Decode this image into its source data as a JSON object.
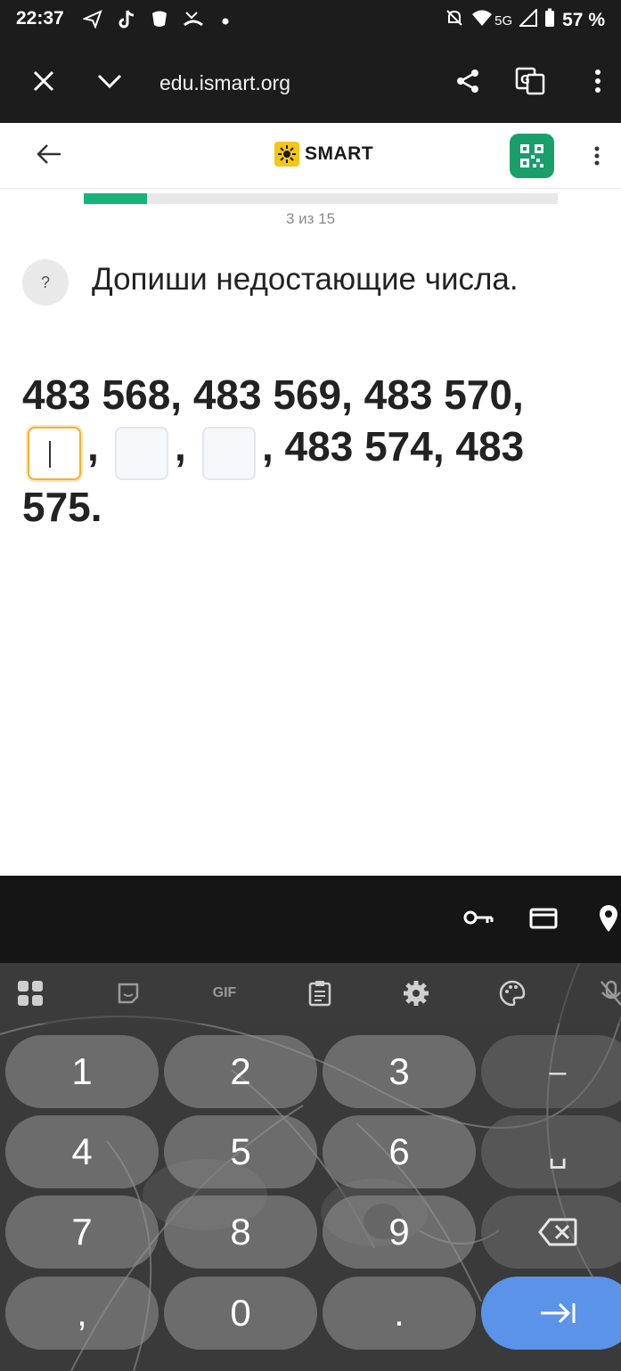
{
  "status_bar": {
    "time": "22:37",
    "network": "5G",
    "battery": "57 %"
  },
  "browser": {
    "url": "edu.ismart.org"
  },
  "app": {
    "logo_text": "SMART",
    "progress": {
      "current": 3,
      "total": 15,
      "label": "3 из 15",
      "fraction": 0.133
    },
    "help_label": "?",
    "question": "Допиши недостающие числа.",
    "sequence": {
      "part1": "483 568, 483 569, 483 570,",
      "sep1": ",",
      "sep2": ",",
      "part2": ", 483 574, 483",
      "part3": "575."
    }
  },
  "keyboard": {
    "toolbar_label": "GIF",
    "keys": {
      "k1": "1",
      "k2": "2",
      "k3": "3",
      "dash": "–",
      "k4": "4",
      "k5": "5",
      "k6": "6",
      "space": "␣",
      "k7": "7",
      "k8": "8",
      "k9": "9",
      "comma": ",",
      "k0": "0",
      "dot": "."
    }
  },
  "colors": {
    "accent_green": "#17b37a",
    "qr_green": "#1a9e6c",
    "logo_yellow": "#f5c518",
    "active_border": "#f5b030",
    "enter_blue": "#5b93e8"
  }
}
